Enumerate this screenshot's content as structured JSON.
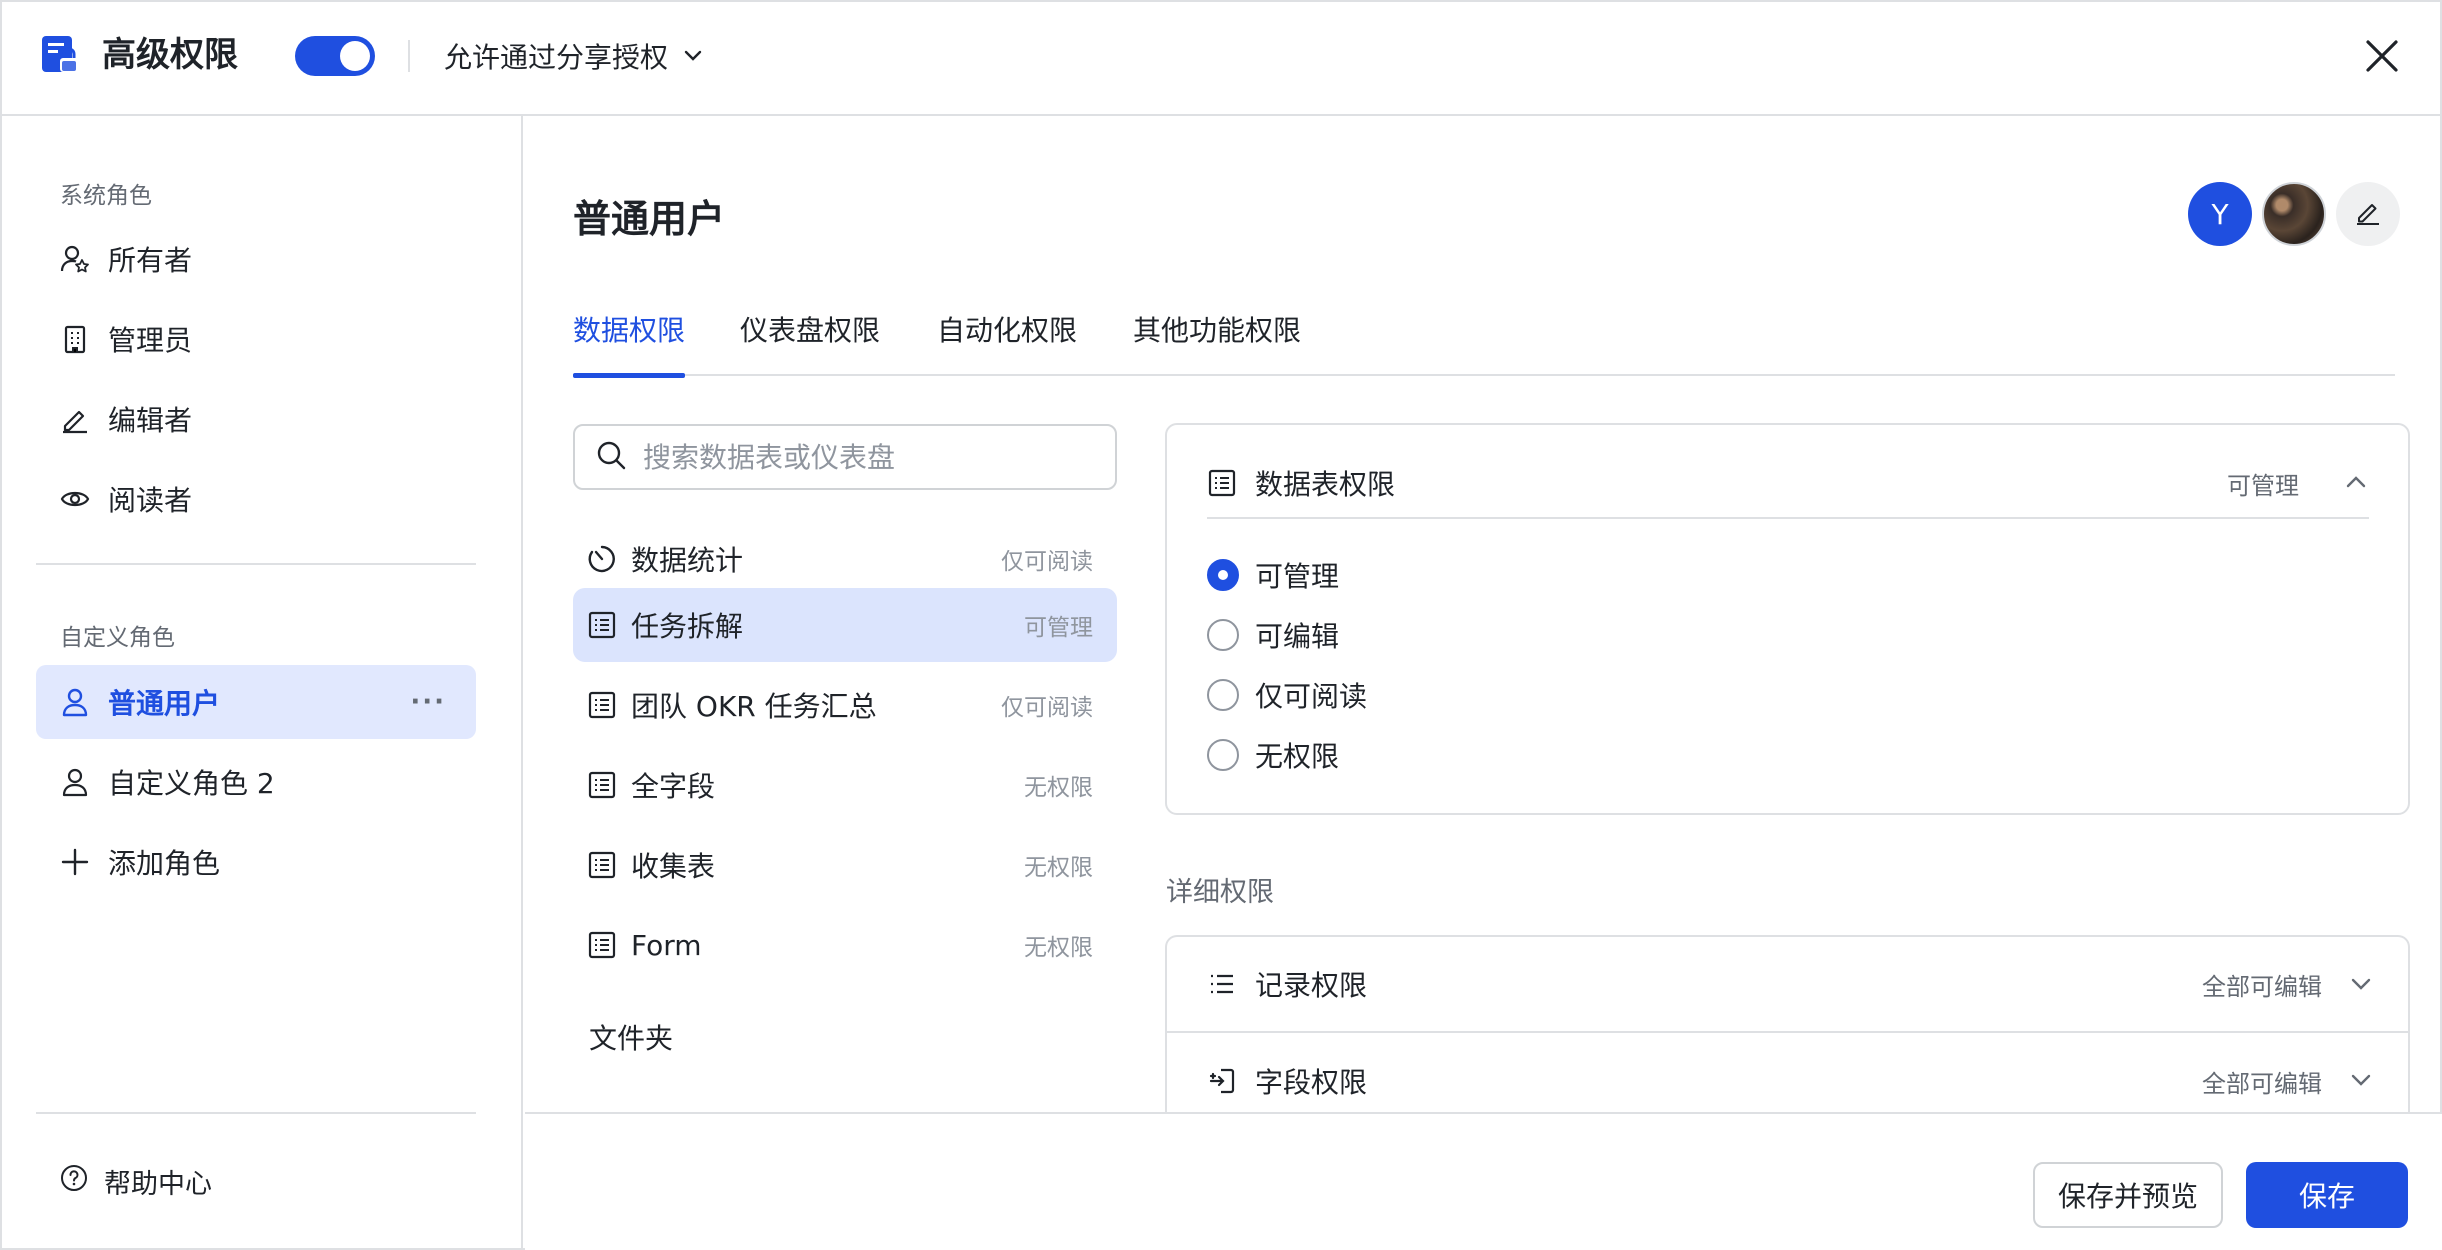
{
  "header": {
    "title": "高级权限",
    "toggle_on": true,
    "share_option": "允许通过分享授权",
    "icons": {
      "app": "permission-doc-icon",
      "close": "close-icon",
      "dropdown": "chevron-down-icon"
    }
  },
  "sidebar": {
    "system_roles_label": "系统角色",
    "system_roles": [
      {
        "label": "所有者",
        "icon": "owner-icon"
      },
      {
        "label": "管理员",
        "icon": "building-icon"
      },
      {
        "label": "编辑者",
        "icon": "pencil-icon"
      },
      {
        "label": "阅读者",
        "icon": "eye-icon"
      }
    ],
    "custom_roles_label": "自定义角色",
    "custom_roles": [
      {
        "label": "普通用户",
        "icon": "user-icon",
        "active": true
      },
      {
        "label": "自定义角色 2",
        "icon": "user-icon",
        "active": false
      }
    ],
    "more_label": "···",
    "add_role": "添加角色",
    "help": "帮助中心"
  },
  "main": {
    "title": "普通用户",
    "avatar_initial": "Y",
    "tabs": [
      {
        "label": "数据权限",
        "active": true
      },
      {
        "label": "仪表盘权限",
        "active": false
      },
      {
        "label": "自动化权限",
        "active": false
      },
      {
        "label": "其他功能权限",
        "active": false
      }
    ],
    "search_placeholder": "搜索数据表或仪表盘",
    "items": [
      {
        "name": "数据统计",
        "perm": "仅可阅读",
        "icon": "dashboard-icon"
      },
      {
        "name": "任务拆解",
        "perm": "可管理",
        "icon": "table-icon",
        "active": true
      },
      {
        "name": "团队 OKR 任务汇总",
        "perm": "仅可阅读",
        "icon": "table-icon"
      },
      {
        "name": "全字段",
        "perm": "无权限",
        "icon": "table-icon"
      },
      {
        "name": "收集表",
        "perm": "无权限",
        "icon": "table-icon"
      },
      {
        "name": "Form",
        "perm": "无权限",
        "icon": "table-icon"
      }
    ],
    "folder": "文件夹",
    "table_perm": {
      "title": "数据表权限",
      "value": "可管理",
      "options": [
        {
          "label": "可管理",
          "checked": true
        },
        {
          "label": "可编辑",
          "checked": false
        },
        {
          "label": "仅可阅读",
          "checked": false
        },
        {
          "label": "无权限",
          "checked": false
        }
      ]
    },
    "detail_title": "详细权限",
    "details": [
      {
        "label": "记录权限",
        "value": "全部可编辑",
        "icon": "list-icon"
      },
      {
        "label": "字段权限",
        "value": "全部可编辑",
        "icon": "field-icon"
      }
    ]
  },
  "footer": {
    "preview_button": "保存并预览",
    "save_button": "保存"
  },
  "colors": {
    "accent": "#1f4fe0",
    "active_bg": "#e1e8fe",
    "border": "#dee0e3",
    "muted_text": "#8f959e"
  }
}
